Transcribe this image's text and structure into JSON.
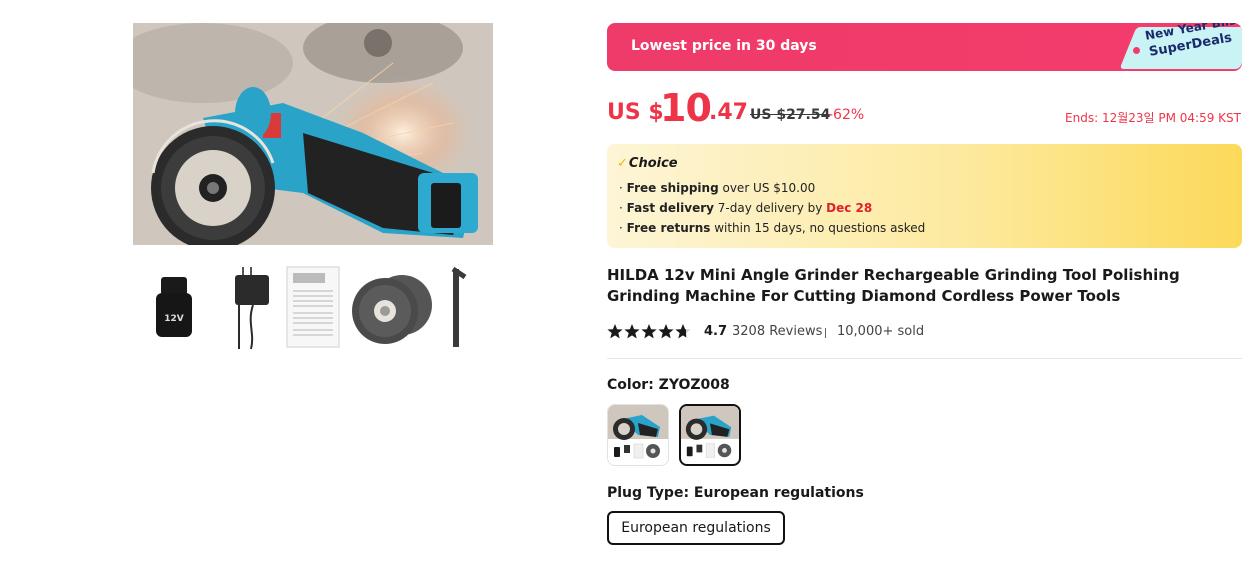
{
  "gallery": {
    "main_image_alt": "Mini angle grinder cutting metal with sparks",
    "thumbnails": [
      {
        "name": "battery",
        "label": "12V"
      },
      {
        "name": "charger"
      },
      {
        "name": "manual"
      },
      {
        "name": "cutting-discs"
      },
      {
        "name": "hex-wrench"
      }
    ]
  },
  "promo": {
    "text": "Lowest price in 30 days",
    "tag_line1": "New Year Bliss",
    "tag_line2": "SuperDeals",
    "colors": {
      "banner": "#f43c6b",
      "tag": "#c9f3f4"
    }
  },
  "price": {
    "currency": "US $",
    "integer": "10",
    "decimal": ".47",
    "original": "US $27.54",
    "discount": "-62%",
    "ends": "Ends: 12월23일 PM 04:59 KST",
    "color": "#ee3449"
  },
  "choice": {
    "title": "Choice",
    "lines": [
      {
        "bold": "Free shipping",
        "text": " over US $10.00"
      },
      {
        "bold": "Fast delivery",
        "text": " 7-day delivery by ",
        "highlight": "Dec 28"
      },
      {
        "bold": "Free returns",
        "text": "  within 15 days, no questions asked"
      }
    ]
  },
  "product": {
    "title": "HILDA 12v Mini Angle Grinder Rechargeable Grinding Tool Polishing Grinding Machine For Cutting Diamond Cordless Power Tools",
    "rating": "4.7",
    "rating_value": 4.7,
    "reviews": "3208 Reviews",
    "sold": "10,000+ sold"
  },
  "options": {
    "color_label": "Color: ZYOZ008",
    "color_swatches": [
      {
        "name": "variant-1",
        "selected": false
      },
      {
        "name": "ZYOZ008",
        "selected": true
      }
    ],
    "plug_label": "Plug Type: European regulations",
    "plug_options": [
      {
        "label": "European regulations",
        "selected": true
      }
    ]
  }
}
